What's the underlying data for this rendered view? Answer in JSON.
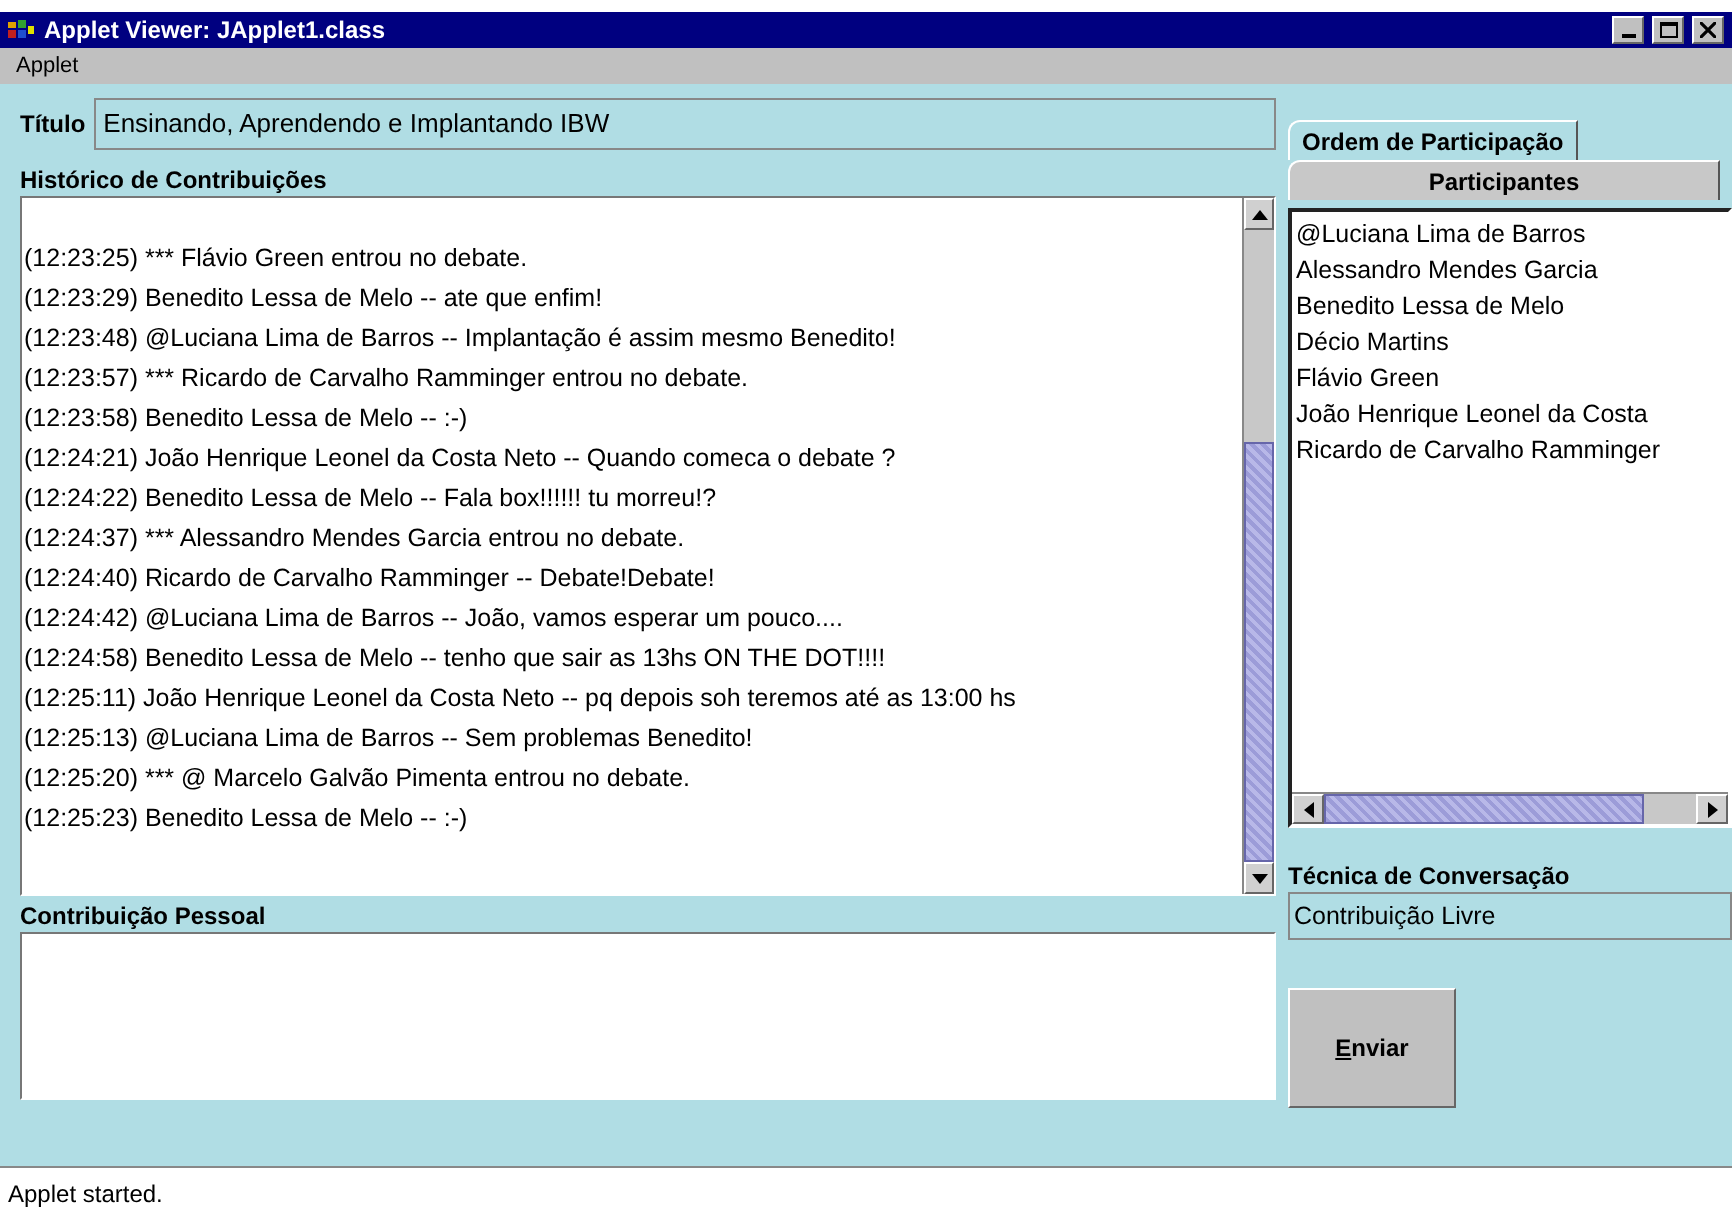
{
  "window": {
    "title": "Applet Viewer: JApplet1.class"
  },
  "menu": [
    "Applet"
  ],
  "title_field": {
    "label": "Título",
    "value": "Ensinando, Aprendendo e Implantando IBW"
  },
  "history": {
    "label": "Histórico de Contribuições",
    "lines": [
      "(12:23:25) *** Flávio Green entrou no debate.",
      "(12:23:29) Benedito Lessa de Melo -- ate que enfim!",
      "(12:23:48) @Luciana Lima de Barros -- Implantação é assim mesmo Benedito!",
      "(12:23:57) *** Ricardo de Carvalho Ramminger entrou no debate.",
      "(12:23:58) Benedito Lessa de Melo -- :-)",
      "(12:24:21) João Henrique Leonel da Costa Neto -- Quando comeca o debate ?",
      "(12:24:22) Benedito Lessa de Melo -- Fala box!!!!!! tu morreu!?",
      "(12:24:37) *** Alessandro Mendes Garcia entrou no debate.",
      "(12:24:40) Ricardo de Carvalho Ramminger -- Debate!Debate!",
      "(12:24:42) @Luciana Lima de Barros -- João, vamos esperar um pouco....",
      "(12:24:58) Benedito Lessa de Melo -- tenho que sair as 13hs ON THE DOT!!!!",
      "(12:25:11) João Henrique Leonel da Costa Neto -- pq depois soh teremos até as 13:00 hs",
      "(12:25:13) @Luciana Lima de Barros -- Sem problemas Benedito!",
      "(12:25:20) *** @ Marcelo Galvão Pimenta entrou no debate.",
      "(12:25:23) Benedito Lessa de Melo -- :-)"
    ]
  },
  "tabs": [
    {
      "label": "Ordem de Participação",
      "selected": false
    },
    {
      "label": "Participantes",
      "selected": true
    }
  ],
  "participants": [
    "@Luciana Lima de Barros",
    "Alessandro Mendes Garcia",
    "Benedito Lessa de Melo",
    "Décio Martins",
    "Flávio Green",
    "João Henrique Leonel da Costa",
    "Ricardo de Carvalho Ramminger"
  ],
  "technique": {
    "label": "Técnica de Conversação",
    "value": "Contribuição Livre"
  },
  "contribution": {
    "label": "Contribuição Pessoal"
  },
  "send_button": "Enviar",
  "status_bar": "Applet started."
}
